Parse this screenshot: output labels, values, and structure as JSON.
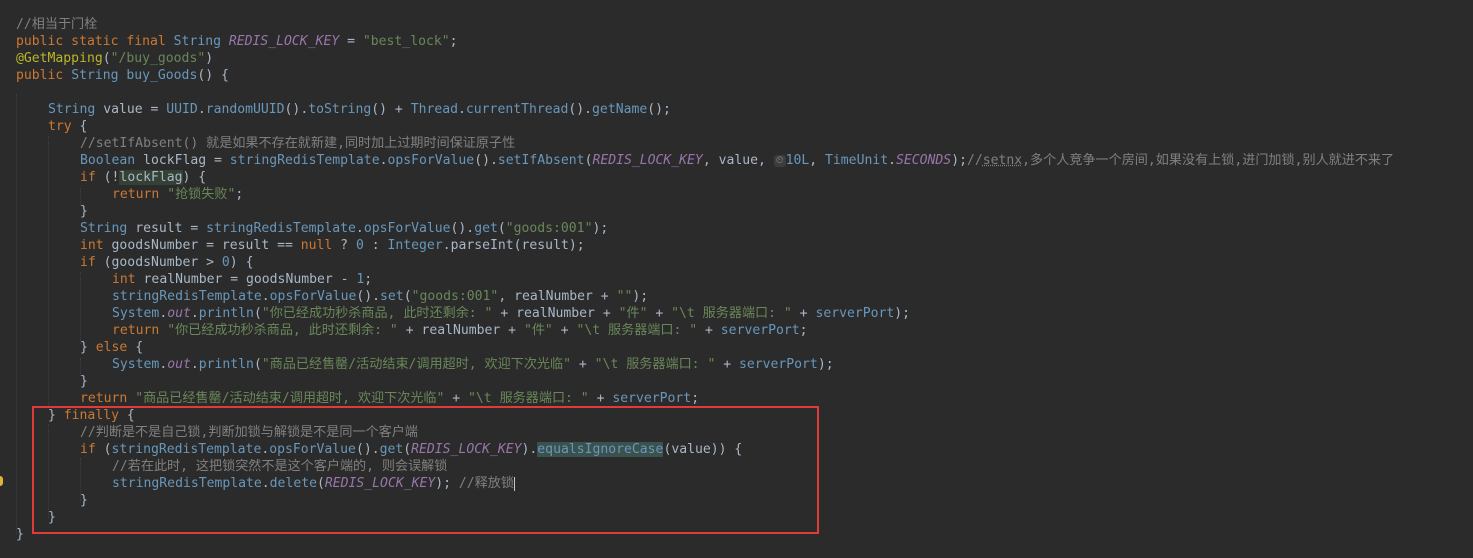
{
  "lines": [
    {
      "indent": 0,
      "segs": [
        {
          "c": "cmt",
          "t": "//相当于门栓"
        }
      ]
    },
    {
      "indent": 0,
      "segs": [
        {
          "c": "kw",
          "t": "public static final "
        },
        {
          "c": "typ",
          "t": "String "
        },
        {
          "c": "cst",
          "t": "REDIS_LOCK_KEY"
        },
        {
          "c": "",
          "t": " = "
        },
        {
          "c": "str",
          "t": "\"best_lock\""
        },
        {
          "c": "",
          "t": ";"
        }
      ]
    },
    {
      "indent": 0,
      "segs": [
        {
          "c": "ann",
          "t": "@GetMapping"
        },
        {
          "c": "",
          "t": "("
        },
        {
          "c": "str",
          "t": "\"/buy_goods\""
        },
        {
          "c": "",
          "t": ")"
        }
      ]
    },
    {
      "indent": 0,
      "segs": [
        {
          "c": "kw",
          "t": "public "
        },
        {
          "c": "typ",
          "t": "String "
        },
        {
          "c": "fn",
          "t": "buy_Goods"
        },
        {
          "c": "",
          "t": "() {"
        }
      ]
    },
    {
      "indent": 0,
      "segs": []
    },
    {
      "indent": 1,
      "segs": [
        {
          "c": "typ",
          "t": "String "
        },
        {
          "c": "",
          "t": "value = "
        },
        {
          "c": "typ",
          "t": "UUID"
        },
        {
          "c": "",
          "t": "."
        },
        {
          "c": "fn",
          "t": "randomUUID"
        },
        {
          "c": "",
          "t": "()."
        },
        {
          "c": "fn",
          "t": "toString"
        },
        {
          "c": "",
          "t": "() + "
        },
        {
          "c": "typ",
          "t": "Thread"
        },
        {
          "c": "",
          "t": "."
        },
        {
          "c": "fn",
          "t": "currentThread"
        },
        {
          "c": "",
          "t": "()."
        },
        {
          "c": "fn",
          "t": "getName"
        },
        {
          "c": "",
          "t": "();"
        }
      ]
    },
    {
      "indent": 1,
      "segs": [
        {
          "c": "kw",
          "t": "try "
        },
        {
          "c": "",
          "t": "{"
        }
      ]
    },
    {
      "indent": 2,
      "segs": [
        {
          "c": "cmt",
          "t": "//setIfAbsent() 就是如果不存在就新建,同时加上过期时间保证原子性"
        }
      ]
    },
    {
      "indent": 2,
      "segs": [
        {
          "c": "typ",
          "t": "Boolean "
        },
        {
          "c": "",
          "t": "lockFlag = "
        },
        {
          "c": "fn",
          "t": "stringRedisTemplate"
        },
        {
          "c": "",
          "t": "."
        },
        {
          "c": "fn",
          "t": "opsForValue"
        },
        {
          "c": "",
          "t": "()."
        },
        {
          "c": "fn",
          "t": "setIfAbsent"
        },
        {
          "c": "",
          "t": "("
        },
        {
          "c": "cst",
          "t": "REDIS_LOCK_KEY"
        },
        {
          "c": "",
          "t": ", value, "
        },
        {
          "c": "hint",
          "t": "⏲"
        },
        {
          "c": "num",
          "t": "10L"
        },
        {
          "c": "",
          "t": ", "
        },
        {
          "c": "typ",
          "t": "TimeUnit"
        },
        {
          "c": "",
          "t": "."
        },
        {
          "c": "cst",
          "t": "SECONDS"
        },
        {
          "c": "",
          "t": ");"
        },
        {
          "c": "cmt",
          "t": "//"
        },
        {
          "c": "cmt ulc",
          "t": "setnx"
        },
        {
          "c": "cmt",
          "t": ",多个人竞争一个房间,如果没有上锁,进门加锁,别人就进不来了"
        }
      ]
    },
    {
      "indent": 2,
      "segs": [
        {
          "c": "kw",
          "t": "if "
        },
        {
          "c": "",
          "t": "(!"
        },
        {
          "c": "hl",
          "t": "lockFlag"
        },
        {
          "c": "",
          "t": ") {"
        }
      ]
    },
    {
      "indent": 3,
      "segs": [
        {
          "c": "kw",
          "t": "return "
        },
        {
          "c": "str",
          "t": "\"抢锁失败\""
        },
        {
          "c": "",
          "t": ";"
        }
      ]
    },
    {
      "indent": 2,
      "segs": [
        {
          "c": "",
          "t": "}"
        }
      ]
    },
    {
      "indent": 2,
      "segs": [
        {
          "c": "typ",
          "t": "String "
        },
        {
          "c": "",
          "t": "result = "
        },
        {
          "c": "fn",
          "t": "stringRedisTemplate"
        },
        {
          "c": "",
          "t": "."
        },
        {
          "c": "fn",
          "t": "opsForValue"
        },
        {
          "c": "",
          "t": "()."
        },
        {
          "c": "fn",
          "t": "get"
        },
        {
          "c": "",
          "t": "("
        },
        {
          "c": "str",
          "t": "\"goods:001\""
        },
        {
          "c": "",
          "t": ");"
        }
      ]
    },
    {
      "indent": 2,
      "segs": [
        {
          "c": "kw",
          "t": "int "
        },
        {
          "c": "",
          "t": "goodsNumber = result == "
        },
        {
          "c": "kw",
          "t": "null "
        },
        {
          "c": "",
          "t": "? "
        },
        {
          "c": "num",
          "t": "0 "
        },
        {
          "c": "",
          "t": ": "
        },
        {
          "c": "typ",
          "t": "Integer"
        },
        {
          "c": "",
          "t": ".parseInt(result);"
        }
      ]
    },
    {
      "indent": 2,
      "segs": [
        {
          "c": "kw",
          "t": "if "
        },
        {
          "c": "",
          "t": "(goodsNumber > "
        },
        {
          "c": "num",
          "t": "0"
        },
        {
          "c": "",
          "t": ") {"
        }
      ]
    },
    {
      "indent": 3,
      "segs": [
        {
          "c": "kw",
          "t": "int "
        },
        {
          "c": "",
          "t": "realNumber = goodsNumber - "
        },
        {
          "c": "num",
          "t": "1"
        },
        {
          "c": "",
          "t": ";"
        }
      ]
    },
    {
      "indent": 3,
      "segs": [
        {
          "c": "fn",
          "t": "stringRedisTemplate"
        },
        {
          "c": "",
          "t": "."
        },
        {
          "c": "fn",
          "t": "opsForValue"
        },
        {
          "c": "",
          "t": "()."
        },
        {
          "c": "fn",
          "t": "set"
        },
        {
          "c": "",
          "t": "("
        },
        {
          "c": "str",
          "t": "\"goods:001\""
        },
        {
          "c": "",
          "t": ", realNumber + "
        },
        {
          "c": "str",
          "t": "\"\""
        },
        {
          "c": "",
          "t": ");"
        }
      ]
    },
    {
      "indent": 3,
      "segs": [
        {
          "c": "typ",
          "t": "System"
        },
        {
          "c": "",
          "t": "."
        },
        {
          "c": "cst",
          "t": "out"
        },
        {
          "c": "",
          "t": "."
        },
        {
          "c": "fn",
          "t": "println"
        },
        {
          "c": "",
          "t": "("
        },
        {
          "c": "str",
          "t": "\"你已经成功秒杀商品, 此时还剩余: \""
        },
        {
          "c": "",
          "t": " + realNumber + "
        },
        {
          "c": "str",
          "t": "\"件\""
        },
        {
          "c": "",
          "t": " + "
        },
        {
          "c": "str",
          "t": "\"\\t 服务器端口: \""
        },
        {
          "c": "",
          "t": " + "
        },
        {
          "c": "fn",
          "t": "serverPort"
        },
        {
          "c": "",
          "t": ");"
        }
      ]
    },
    {
      "indent": 3,
      "segs": [
        {
          "c": "kw",
          "t": "return "
        },
        {
          "c": "str",
          "t": "\"你已经成功秒杀商品, 此时还剩余: \""
        },
        {
          "c": "",
          "t": " + realNumber + "
        },
        {
          "c": "str",
          "t": "\"件\""
        },
        {
          "c": "",
          "t": " + "
        },
        {
          "c": "str",
          "t": "\"\\t 服务器端口: \""
        },
        {
          "c": "",
          "t": " + "
        },
        {
          "c": "fn",
          "t": "serverPort"
        },
        {
          "c": "",
          "t": ";"
        }
      ]
    },
    {
      "indent": 2,
      "segs": [
        {
          "c": "",
          "t": "} "
        },
        {
          "c": "kw",
          "t": "else "
        },
        {
          "c": "",
          "t": "{"
        }
      ]
    },
    {
      "indent": 3,
      "segs": [
        {
          "c": "typ",
          "t": "System"
        },
        {
          "c": "",
          "t": "."
        },
        {
          "c": "cst",
          "t": "out"
        },
        {
          "c": "",
          "t": "."
        },
        {
          "c": "fn",
          "t": "println"
        },
        {
          "c": "",
          "t": "("
        },
        {
          "c": "str",
          "t": "\"商品已经售罄/活动结束/调用超时, 欢迎下次光临\""
        },
        {
          "c": "",
          "t": " + "
        },
        {
          "c": "str",
          "t": "\"\\t 服务器端口: \""
        },
        {
          "c": "",
          "t": " + "
        },
        {
          "c": "fn",
          "t": "serverPort"
        },
        {
          "c": "",
          "t": ");"
        }
      ]
    },
    {
      "indent": 2,
      "segs": [
        {
          "c": "",
          "t": "}"
        }
      ]
    },
    {
      "indent": 2,
      "segs": [
        {
          "c": "kw",
          "t": "return "
        },
        {
          "c": "str",
          "t": "\"商品已经售罄/活动结束/调用超时, 欢迎下次光临\""
        },
        {
          "c": "",
          "t": " + "
        },
        {
          "c": "str",
          "t": "\"\\t 服务器端口: \""
        },
        {
          "c": "",
          "t": " + "
        },
        {
          "c": "fn",
          "t": "serverPort"
        },
        {
          "c": "",
          "t": ";"
        }
      ]
    },
    {
      "indent": 1,
      "segs": [
        {
          "c": "",
          "t": "} "
        },
        {
          "c": "kw",
          "t": "finally "
        },
        {
          "c": "",
          "t": "{"
        }
      ]
    },
    {
      "indent": 2,
      "segs": [
        {
          "c": "cmt",
          "t": "//判断是不是自己锁,判断加锁与解锁是不是同一个客户端"
        }
      ]
    },
    {
      "indent": 2,
      "segs": [
        {
          "c": "kw",
          "t": "if "
        },
        {
          "c": "",
          "t": "("
        },
        {
          "c": "fn",
          "t": "stringRedisTemplate"
        },
        {
          "c": "",
          "t": "."
        },
        {
          "c": "fn",
          "t": "opsForValue"
        },
        {
          "c": "",
          "t": "()."
        },
        {
          "c": "fn",
          "t": "get"
        },
        {
          "c": "",
          "t": "("
        },
        {
          "c": "cst",
          "t": "REDIS_LOCK_KEY"
        },
        {
          "c": "",
          "t": ")."
        },
        {
          "c": "hl2 fn",
          "t": "equalsIgnoreCase"
        },
        {
          "c": "",
          "t": "(value)) {"
        }
      ]
    },
    {
      "indent": 3,
      "segs": [
        {
          "c": "cmt",
          "t": "//若在此时, 这把锁突然不是这个客户端的, 则会误解锁"
        }
      ]
    },
    {
      "indent": 3,
      "segs": [
        {
          "c": "fn",
          "t": "stringRedisTemplate"
        },
        {
          "c": "",
          "t": "."
        },
        {
          "c": "fn",
          "t": "delete"
        },
        {
          "c": "",
          "t": "("
        },
        {
          "c": "cst",
          "t": "REDIS_LOCK_KEY"
        },
        {
          "c": "",
          "t": "); "
        },
        {
          "c": "cmt",
          "t": "//释放锁"
        },
        {
          "c": "caret",
          "t": ""
        }
      ]
    },
    {
      "indent": 2,
      "segs": [
        {
          "c": "",
          "t": "}"
        }
      ]
    },
    {
      "indent": 1,
      "segs": [
        {
          "c": "",
          "t": "}"
        }
      ]
    },
    {
      "indent": 0,
      "segs": [
        {
          "c": "",
          "t": "}"
        }
      ]
    }
  ]
}
